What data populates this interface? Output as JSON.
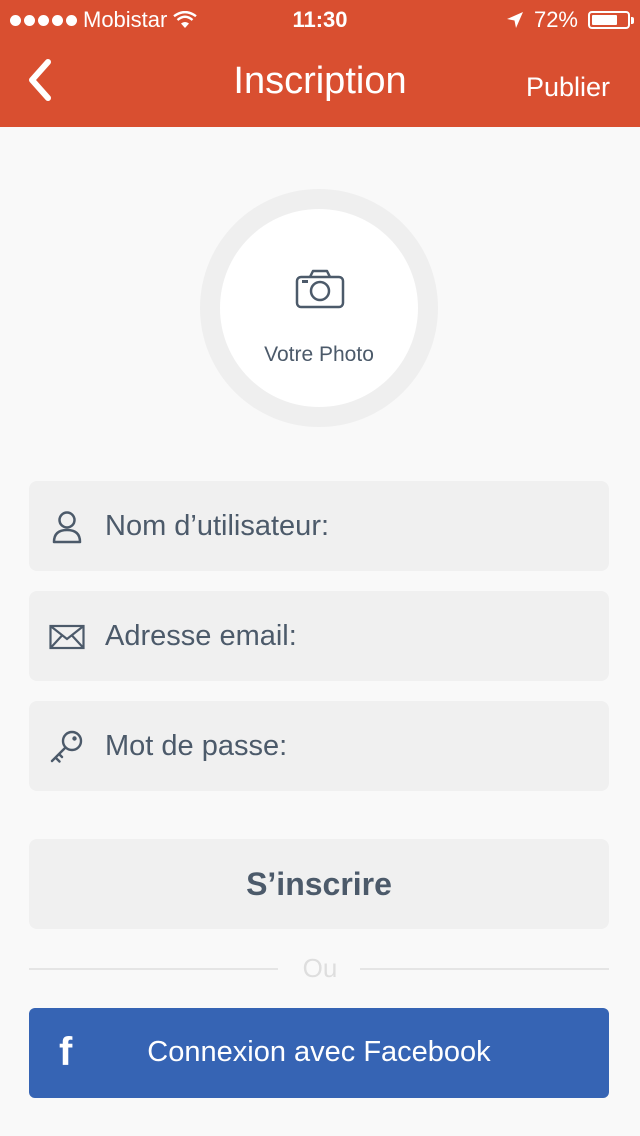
{
  "status_bar": {
    "carrier": "Mobistar",
    "time": "11:30",
    "battery": "72%",
    "battery_level": 0.72
  },
  "nav": {
    "title": "Inscription",
    "publish_label": "Publier"
  },
  "photo": {
    "label": "Votre Photo"
  },
  "form": {
    "username_placeholder": "Nom d’utilisateur:",
    "email_placeholder": "Adresse email:",
    "password_placeholder": "Mot de passe:",
    "signup_label": "S’inscrire",
    "or_label": "Ou",
    "facebook_label": "Connexion avec Facebook",
    "facebook_letter": "f"
  },
  "colors": {
    "header": "#d94f30",
    "facebook": "#3664b4",
    "text": "#4c5a6a"
  }
}
